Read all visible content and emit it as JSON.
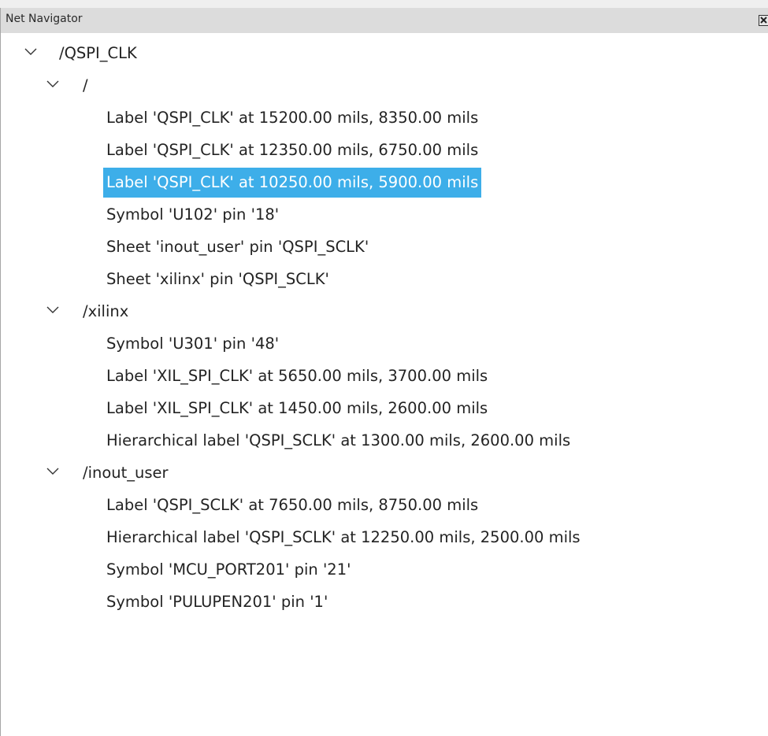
{
  "panel": {
    "title": "Net Navigator"
  },
  "tree": {
    "net": {
      "label": "/QSPI_CLK"
    },
    "sheets": [
      {
        "label": "/",
        "items": [
          "Label 'QSPI_CLK' at 15200.00 mils, 8350.00 mils",
          "Label 'QSPI_CLK' at 12350.00 mils, 6750.00 mils",
          "Label 'QSPI_CLK' at 10250.00 mils, 5900.00 mils",
          "Symbol 'U102' pin '18'",
          "Sheet 'inout_user' pin 'QSPI_SCLK'",
          "Sheet 'xilinx' pin 'QSPI_SCLK'"
        ]
      },
      {
        "label": "/xilinx",
        "items": [
          "Symbol 'U301' pin '48'",
          "Label 'XIL_SPI_CLK' at 5650.00 mils, 3700.00 mils",
          "Label 'XIL_SPI_CLK' at 1450.00 mils, 2600.00 mils",
          "Hierarchical label 'QSPI_SCLK' at 1300.00 mils, 2600.00 mils"
        ]
      },
      {
        "label": "/inout_user",
        "items": [
          "Label 'QSPI_SCLK' at 7650.00 mils, 8750.00 mils",
          "Hierarchical label 'QSPI_SCLK' at 12250.00 mils, 2500.00 mils",
          "Symbol 'MCU_PORT201' pin '21'",
          "Symbol 'PULUPEN201' pin '1'"
        ]
      }
    ],
    "selected_item": "Label 'QSPI_CLK' at 10250.00 mils, 5900.00 mils"
  },
  "icons": {
    "close": "close-icon",
    "expand": "chevron-down-icon"
  },
  "colors": {
    "selection": "#3daee9",
    "titlebar": "#dcdcdc"
  }
}
